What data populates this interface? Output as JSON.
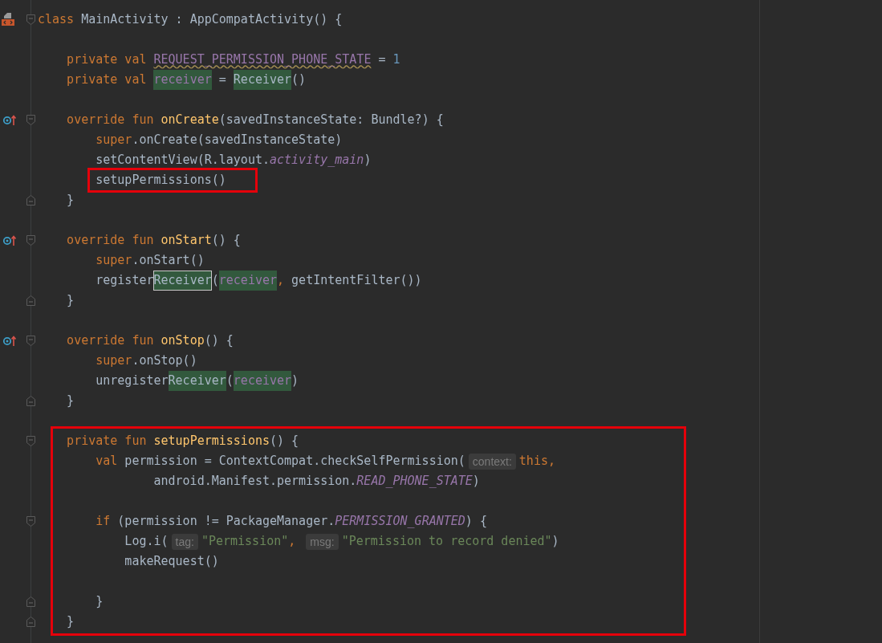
{
  "editor": {
    "lines": [
      {
        "kind": "code",
        "class_marker": true,
        "foldable": true,
        "tokens": [
          {
            "kind": "kw",
            "text": "class"
          },
          {
            "kind": "plain",
            "text": " MainActivity : AppCompatActivity() {"
          }
        ],
        "children": [
          {
            "kind": "blank"
          },
          {
            "kind": "code",
            "tokens": [
              {
                "kind": "kw",
                "text": "private val "
              },
              {
                "kind": "unused",
                "text": "REQUEST_PERMISSION_PHONE_STATE"
              },
              {
                "kind": "plain",
                "text": " = "
              },
              {
                "kind": "num",
                "text": "1"
              }
            ]
          },
          {
            "kind": "code",
            "tokens": [
              {
                "kind": "kw",
                "text": "private val "
              },
              {
                "kind": "prop",
                "text": "receiver",
                "highlighted": true
              },
              {
                "kind": "plain",
                "text": " = "
              },
              {
                "kind": "plain",
                "text": "Receiver",
                "highlighted": true
              },
              {
                "kind": "plain",
                "text": "()"
              }
            ]
          },
          {
            "kind": "blank"
          },
          {
            "kind": "code",
            "overrides": true,
            "foldable": true,
            "tokens": [
              {
                "kind": "kw",
                "text": "override fun "
              },
              {
                "kind": "decl",
                "text": "onCreate"
              },
              {
                "kind": "plain",
                "text": "(savedInstanceState: Bundle?) {"
              }
            ],
            "children": [
              {
                "kind": "code",
                "tokens": [
                  {
                    "kind": "kw",
                    "text": "super"
                  },
                  {
                    "kind": "plain",
                    "text": ".onCreate(savedInstanceState)"
                  }
                ]
              },
              {
                "kind": "code",
                "tokens": [
                  {
                    "kind": "plain",
                    "text": "setContentView(R.layout."
                  },
                  {
                    "kind": "static",
                    "text": "activity_main"
                  },
                  {
                    "kind": "plain",
                    "text": ")"
                  }
                ]
              },
              {
                "kind": "code",
                "tokens": [
                  {
                    "kind": "plain",
                    "text": "setupPermissions()",
                    "boxed": true
                  }
                ]
              }
            ],
            "closing": {
              "text": "}"
            }
          },
          {
            "kind": "blank"
          },
          {
            "kind": "code",
            "overrides": true,
            "foldable": true,
            "tokens": [
              {
                "kind": "kw",
                "text": "override fun "
              },
              {
                "kind": "decl",
                "text": "onStart"
              },
              {
                "kind": "plain",
                "text": "() {"
              }
            ],
            "children": [
              {
                "kind": "code",
                "tokens": [
                  {
                    "kind": "kw",
                    "text": "super"
                  },
                  {
                    "kind": "plain",
                    "text": ".onStart()"
                  }
                ]
              },
              {
                "kind": "code",
                "tokens": [
                  {
                    "kind": "plain",
                    "text": "register"
                  },
                  {
                    "kind": "plain",
                    "text": "Receiver",
                    "highlighted": true,
                    "focused": true
                  },
                  {
                    "kind": "plain",
                    "text": "("
                  },
                  {
                    "kind": "prop",
                    "text": "receiver",
                    "highlighted": true
                  },
                  {
                    "kind": "kw",
                    "text": ","
                  },
                  {
                    "kind": "plain",
                    "text": " getIntentFilter())"
                  }
                ]
              }
            ],
            "closing": {
              "text": "}"
            }
          },
          {
            "kind": "blank"
          },
          {
            "kind": "code",
            "overrides": true,
            "foldable": true,
            "tokens": [
              {
                "kind": "kw",
                "text": "override fun "
              },
              {
                "kind": "decl",
                "text": "onStop"
              },
              {
                "kind": "plain",
                "text": "() {"
              }
            ],
            "children": [
              {
                "kind": "code",
                "tokens": [
                  {
                    "kind": "kw",
                    "text": "super"
                  },
                  {
                    "kind": "plain",
                    "text": ".onStop()"
                  }
                ]
              },
              {
                "kind": "code",
                "tokens": [
                  {
                    "kind": "plain",
                    "text": "unregister"
                  },
                  {
                    "kind": "plain",
                    "text": "Receiver",
                    "highlighted": true
                  },
                  {
                    "kind": "plain",
                    "text": "("
                  },
                  {
                    "kind": "prop",
                    "text": "receiver",
                    "highlighted": true
                  },
                  {
                    "kind": "plain",
                    "text": ")"
                  }
                ]
              }
            ],
            "closing": {
              "text": "}"
            }
          },
          {
            "kind": "blank"
          },
          {
            "kind": "code",
            "foldable": true,
            "outlined": true,
            "tokens": [
              {
                "kind": "kw",
                "text": "private fun "
              },
              {
                "kind": "decl",
                "text": "setupPermissions"
              },
              {
                "kind": "plain",
                "text": "() {"
              }
            ],
            "children": [
              {
                "kind": "code",
                "tokens": [
                  {
                    "kind": "kw",
                    "text": "val "
                  },
                  {
                    "kind": "plain",
                    "text": "permission = ContextCompat.checkSelfPermission("
                  },
                  {
                    "kind": "hint",
                    "text": "context:"
                  },
                  {
                    "kind": "kw",
                    "text": "this,"
                  }
                ],
                "children": [
                  {
                    "kind": "continuation",
                    "tokens": [
                      {
                        "kind": "plain",
                        "text": "android.Manifest.permission."
                      },
                      {
                        "kind": "static",
                        "text": "READ_PHONE_STATE"
                      },
                      {
                        "kind": "plain",
                        "text": ")"
                      }
                    ]
                  }
                ]
              },
              {
                "kind": "blank"
              },
              {
                "kind": "code",
                "foldable": true,
                "tokens": [
                  {
                    "kind": "kw",
                    "text": "if "
                  },
                  {
                    "kind": "plain",
                    "text": "(permission != PackageManager."
                  },
                  {
                    "kind": "static",
                    "text": "PERMISSION_GRANTED"
                  },
                  {
                    "kind": "plain",
                    "text": ") {"
                  }
                ],
                "children": [
                  {
                    "kind": "code",
                    "tokens": [
                      {
                        "kind": "plain",
                        "text": "Log.i("
                      },
                      {
                        "kind": "hint",
                        "text": "tag:"
                      },
                      {
                        "kind": "str",
                        "text": "\"Permission\""
                      },
                      {
                        "kind": "kw",
                        "text": ", "
                      },
                      {
                        "kind": "hint",
                        "text": "msg:"
                      },
                      {
                        "kind": "str",
                        "text": "\"Permission to record denied\""
                      },
                      {
                        "kind": "plain",
                        "text": ")"
                      }
                    ]
                  },
                  {
                    "kind": "code",
                    "tokens": [
                      {
                        "kind": "plain",
                        "text": "makeRequest()"
                      }
                    ]
                  },
                  {
                    "kind": "blank"
                  }
                ],
                "closing": {
                  "text": "}"
                }
              }
            ],
            "closing": {
              "text": "}"
            }
          }
        ]
      }
    ]
  }
}
